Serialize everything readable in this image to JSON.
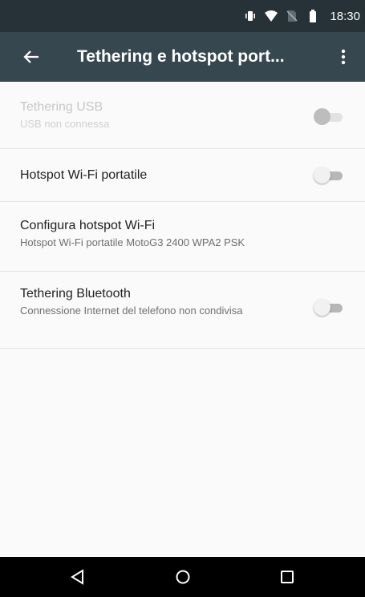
{
  "status_bar": {
    "time": "18:30",
    "icons": [
      "vibrate-icon",
      "wifi-icon",
      "no-sim-icon",
      "battery-icon"
    ]
  },
  "app_bar": {
    "title": "Tethering e hotspot port...",
    "back_icon": "arrow-back-icon",
    "overflow_icon": "more-vert-icon"
  },
  "settings": [
    {
      "title": "Tethering USB",
      "subtitle": "USB non connessa",
      "toggle": "off",
      "enabled": false
    },
    {
      "title": "Hotspot Wi-Fi portatile",
      "toggle": "off",
      "enabled": true
    },
    {
      "title": "Configura hotspot Wi-Fi",
      "subtitle": "Hotspot Wi-Fi portatile MotoG3 2400 WPA2 PSK",
      "enabled": true
    },
    {
      "title": "Tethering Bluetooth",
      "subtitle": "Connessione Internet del telefono non condivisa",
      "toggle": "off",
      "enabled": true
    }
  ],
  "nav_bar": {
    "icons": [
      "back-triangle-icon",
      "home-circle-icon",
      "recents-square-icon"
    ]
  },
  "colors": {
    "status_bar": "#263238",
    "app_bar": "#37474f",
    "background": "#fafafa",
    "nav_bar": "#000000"
  }
}
